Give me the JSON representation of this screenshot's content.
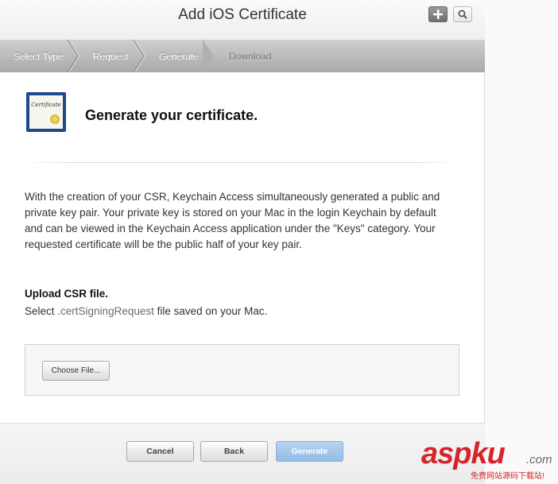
{
  "header": {
    "title": "Add iOS Certificate"
  },
  "toolbar": {
    "add_icon": "plus-icon",
    "search_icon": "search-icon"
  },
  "steps": [
    {
      "label": "Select Type",
      "state": "done"
    },
    {
      "label": "Request",
      "state": "done"
    },
    {
      "label": "Generate",
      "state": "current"
    },
    {
      "label": "Download",
      "state": "upcoming"
    }
  ],
  "certificate": {
    "icon_text": "Certificate"
  },
  "main": {
    "heading": "Generate your certificate.",
    "paragraph": "With the creation of your CSR, Keychain Access simultaneously generated a public and private key pair. Your private key is stored on your Mac in the login Keychain by default and can be viewed in the Keychain Access application under the \"Keys\" category. Your requested certificate will be the public half of your key pair.",
    "upload_heading": "Upload CSR file.",
    "upload_desc_prefix": "Select ",
    "upload_desc_ext": ".certSigningRequest",
    "upload_desc_suffix": " file saved on your Mac.",
    "choose_file_label": "Choose File..."
  },
  "footer": {
    "cancel_label": "Cancel",
    "back_label": "Back",
    "generate_label": "Generate"
  },
  "watermark": {
    "brand": "aspku",
    "tld": ".com",
    "tagline": "免费网站源码下载站!"
  },
  "colors": {
    "accent": "#92bde6",
    "watermark": "#d8232a"
  }
}
